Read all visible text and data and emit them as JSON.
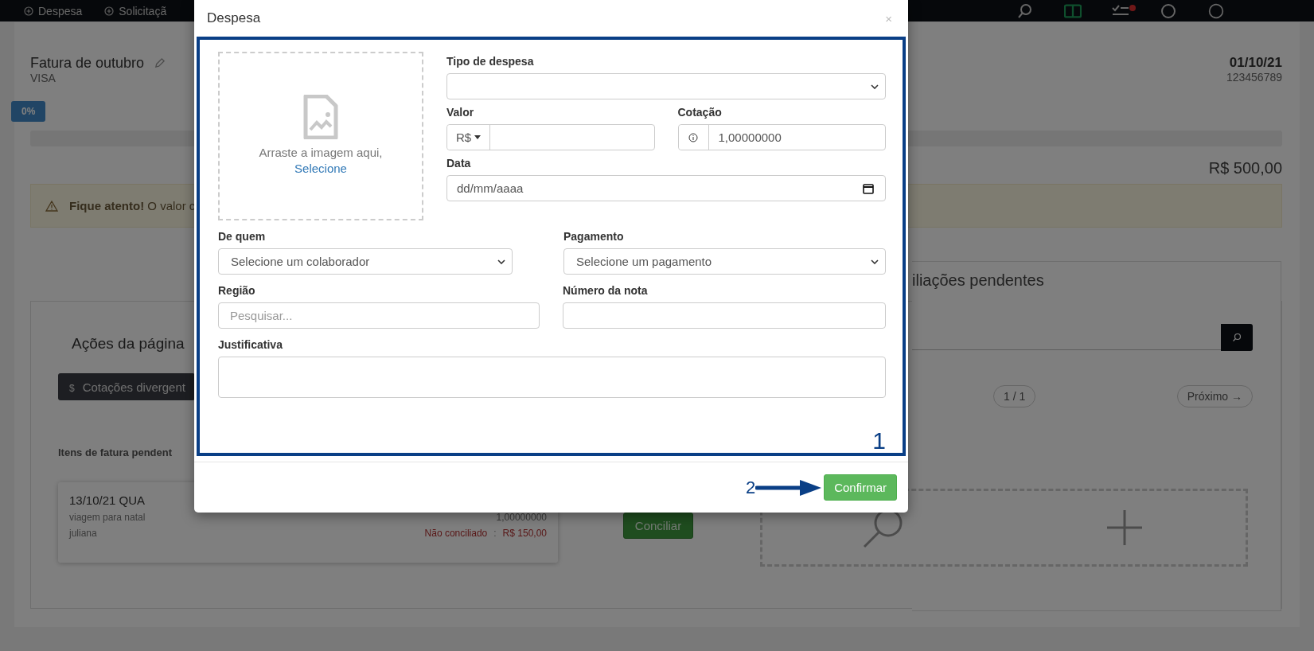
{
  "nav": {
    "items": [
      {
        "label": "Despesa"
      },
      {
        "label": "Solicitaçã"
      }
    ]
  },
  "invoice": {
    "title": "Fatura de outubro",
    "card": "VISA",
    "date": "01/10/21",
    "number": "123456789",
    "progress_label": "0%",
    "progress": {
      "level": 0
    },
    "total": "R$ 500,00"
  },
  "alert": {
    "title": "Fique atento!",
    "text": "O valor c"
  },
  "actions": {
    "title": "Ações da página",
    "button_icon": "$",
    "button": "Cotações divergent"
  },
  "pending": {
    "title": "Itens de fatura pendent",
    "items": [
      {
        "date": "13/10/21 QUA",
        "description": "viagem para natal",
        "rate": "1,00000000",
        "person": "juliana",
        "status": "Não conciliado",
        "separator": ":",
        "amount": "R$ 150,00"
      }
    ]
  },
  "conciliar": "Conciliar",
  "reconciliations": {
    "title": "iliações pendentes",
    "page": "1 / 1",
    "next": "Próximo →"
  },
  "modal": {
    "title": "Despesa",
    "close": "×",
    "dropzone": {
      "text": "Arraste a imagem aqui,",
      "link": "Selecione"
    },
    "side_rows": [
      [
        {
          "kind": "select",
          "label": "Tipo de despesa"
        }
      ],
      [
        {
          "kind": "currency",
          "label": "Valor",
          "prefix": "R$"
        },
        {
          "kind": "addon",
          "label": "Cotação",
          "value": "1,00000000"
        }
      ],
      [
        {
          "kind": "date",
          "label": "Data",
          "placeholder": "dd/mm/aaaa"
        }
      ]
    ],
    "rows": [
      [
        {
          "kind": "select",
          "label": "De quem",
          "value": "Selecione um colaborador"
        },
        {
          "kind": "select",
          "label": "Pagamento",
          "value": "Selecione um pagamento"
        }
      ],
      [
        {
          "kind": "text",
          "label": "Região",
          "placeholder": "Pesquisar..."
        },
        {
          "kind": "text",
          "label": "Número da nota"
        }
      ],
      [
        {
          "kind": "textarea",
          "label": "Justificativa"
        }
      ]
    ],
    "step_labels": [
      "1",
      "2"
    ],
    "confirm": "Confirmar"
  }
}
